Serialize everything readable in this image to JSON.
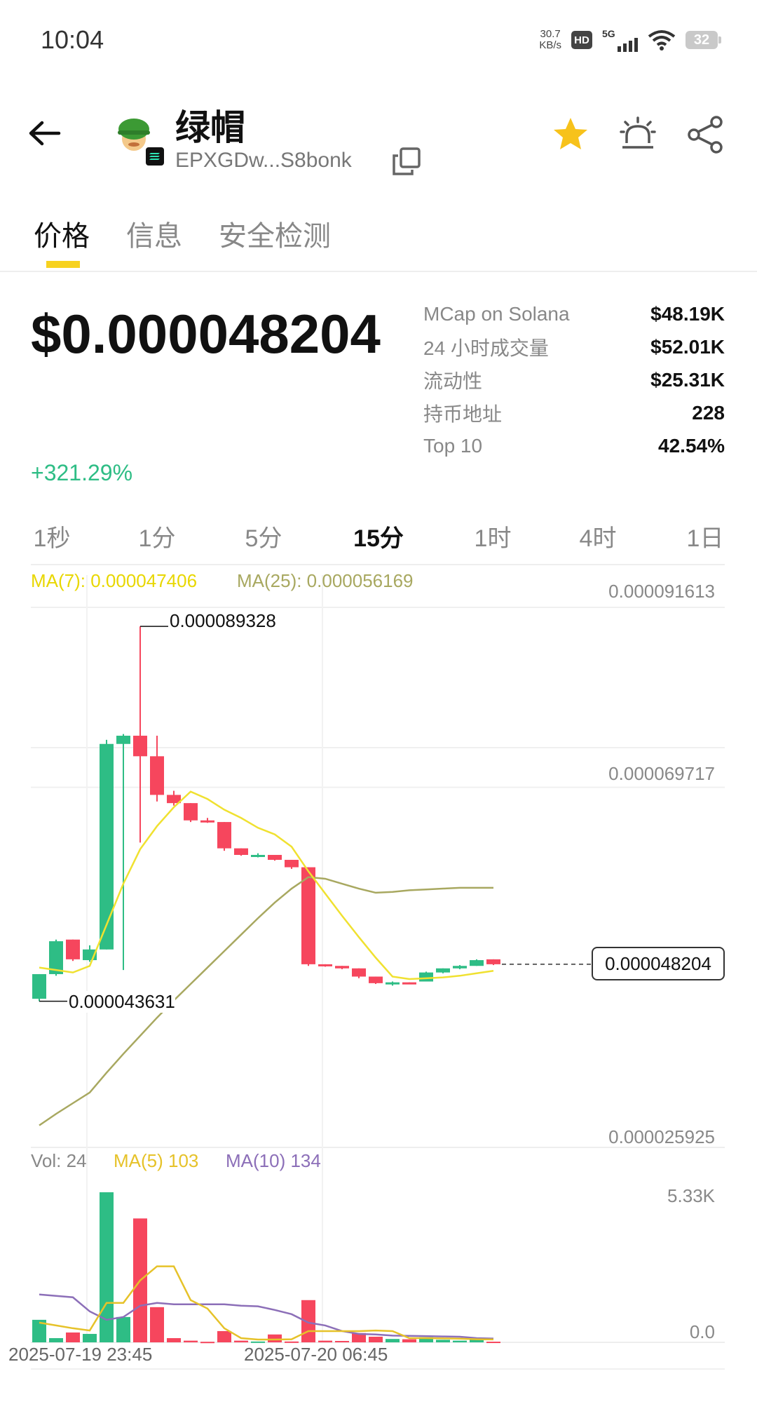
{
  "status": {
    "time": "10:04",
    "net_speed_value": "30.7",
    "net_speed_unit": "KB/s",
    "hd": "HD",
    "network": "5G",
    "battery": "32"
  },
  "header": {
    "token_name": "绿帽",
    "address": "EPXGDw...S8bonk",
    "icons": [
      "back-arrow-icon",
      "token-avatar",
      "solana-chain-icon",
      "copy-icon",
      "star-icon",
      "alarm-icon",
      "share-icon"
    ],
    "star_color": "#f7c21b"
  },
  "tabs": [
    {
      "label": "价格",
      "active": true
    },
    {
      "label": "信息",
      "active": false
    },
    {
      "label": "安全检测",
      "active": false
    }
  ],
  "price": {
    "value": "$0.000048204",
    "change": "+321.29%"
  },
  "stats": [
    {
      "label": "MCap on Solana",
      "value": "$48.19K"
    },
    {
      "label": "24 小时成交量",
      "value": "$52.01K"
    },
    {
      "label": "流动性",
      "value": "$25.31K"
    },
    {
      "label": "持币地址",
      "value": "228"
    },
    {
      "label": "Top 10",
      "value": "42.54%"
    }
  ],
  "timeframes": [
    {
      "label": "1秒",
      "active": false
    },
    {
      "label": "1分",
      "active": false
    },
    {
      "label": "5分",
      "active": false
    },
    {
      "label": "15分",
      "active": true
    },
    {
      "label": "1时",
      "active": false
    },
    {
      "label": "4时",
      "active": false
    },
    {
      "label": "1日",
      "active": false
    }
  ],
  "chart_legend": {
    "ma7": "MA(7): 0.000047406",
    "ma25": "MA(25): 0.000056169",
    "vol": "Vol: 24",
    "vma5": "MA(5) 103",
    "vma10": "MA(10) 134"
  },
  "colors": {
    "up": "#2ebd85",
    "down": "#f6465d",
    "ma7": "#f0e130",
    "ma25": "#a8a860",
    "vma5": "#e6c229",
    "vma10": "#8c6fb8"
  },
  "chart_data": {
    "type": "candlestick",
    "interval": "15分",
    "ylim": [
      2.5925e-05,
      9.1613e-05
    ],
    "y_ticks": [
      "0.000091613",
      "0.000069717",
      "0.000025925"
    ],
    "high_label": "0.000089328",
    "low_label": "0.000043631",
    "current_price_label": "0.000048204",
    "volume_ticks": [
      "5.33K",
      "0.0"
    ],
    "volume_max": 5330,
    "x_ticks": [
      "2025-07-19 23:45",
      "2025-07-20 06:45"
    ],
    "candles": [
      {
        "o": 4.4e-05,
        "h": 4.7e-05,
        "l": 4.37e-05,
        "c": 4.7e-05,
        "v": 800
      },
      {
        "o": 4.7e-05,
        "h": 5.12e-05,
        "l": 4.68e-05,
        "c": 5.1e-05,
        "v": 150
      },
      {
        "o": 5.12e-05,
        "h": 5.12e-05,
        "l": 4.86e-05,
        "c": 4.88e-05,
        "v": 350
      },
      {
        "o": 4.87e-05,
        "h": 5.05e-05,
        "l": 4.85e-05,
        "c": 5e-05,
        "v": 300
      },
      {
        "o": 5e-05,
        "h": 7.55e-05,
        "l": 5e-05,
        "c": 7.5e-05,
        "v": 5330
      },
      {
        "o": 7.5e-05,
        "h": 7.62e-05,
        "l": 4.75e-05,
        "c": 7.6e-05,
        "v": 900
      },
      {
        "o": 7.6e-05,
        "h": 8.93e-05,
        "l": 6.3e-05,
        "c": 7.35e-05,
        "v": 4400
      },
      {
        "o": 7.35e-05,
        "h": 7.6e-05,
        "l": 6.8e-05,
        "c": 6.88e-05,
        "v": 1250
      },
      {
        "o": 6.88e-05,
        "h": 6.93e-05,
        "l": 6.75e-05,
        "c": 6.78e-05,
        "v": 150
      },
      {
        "o": 6.78e-05,
        "h": 6.78e-05,
        "l": 6.55e-05,
        "c": 6.57e-05,
        "v": 60
      },
      {
        "o": 6.57e-05,
        "h": 6.6e-05,
        "l": 6.54e-05,
        "c": 6.55e-05,
        "v": 20
      },
      {
        "o": 6.55e-05,
        "h": 6.55e-05,
        "l": 6.2e-05,
        "c": 6.23e-05,
        "v": 400
      },
      {
        "o": 6.23e-05,
        "h": 6.23e-05,
        "l": 6.14e-05,
        "c": 6.15e-05,
        "v": 60
      },
      {
        "o": 6.14e-05,
        "h": 6.17e-05,
        "l": 6.12e-05,
        "c": 6.15e-05,
        "v": 30
      },
      {
        "o": 6.15e-05,
        "h": 6.15e-05,
        "l": 6.08e-05,
        "c": 6.09e-05,
        "v": 280
      },
      {
        "o": 6.09e-05,
        "h": 6.09e-05,
        "l": 5.98e-05,
        "c": 6e-05,
        "v": 30
      },
      {
        "o": 6e-05,
        "h": 6e-05,
        "l": 4.8e-05,
        "c": 4.82e-05,
        "v": 1500
      },
      {
        "o": 4.82e-05,
        "h": 4.82e-05,
        "l": 4.79e-05,
        "c": 4.8e-05,
        "v": 60
      },
      {
        "o": 4.8e-05,
        "h": 4.8e-05,
        "l": 4.76e-05,
        "c": 4.77e-05,
        "v": 50
      },
      {
        "o": 4.77e-05,
        "h": 4.77e-05,
        "l": 4.65e-05,
        "c": 4.67e-05,
        "v": 330
      },
      {
        "o": 4.67e-05,
        "h": 4.67e-05,
        "l": 4.58e-05,
        "c": 4.59e-05,
        "v": 200
      },
      {
        "o": 4.59e-05,
        "h": 4.61e-05,
        "l": 4.56e-05,
        "c": 4.6e-05,
        "v": 120
      },
      {
        "o": 4.6e-05,
        "h": 4.6e-05,
        "l": 4.58e-05,
        "c": 4.59e-05,
        "v": 110
      },
      {
        "o": 4.61e-05,
        "h": 4.73e-05,
        "l": 4.61e-05,
        "c": 4.72e-05,
        "v": 180
      },
      {
        "o": 4.72e-05,
        "h": 4.77e-05,
        "l": 4.71e-05,
        "c": 4.77e-05,
        "v": 90
      },
      {
        "o": 4.77e-05,
        "h": 4.81e-05,
        "l": 4.76e-05,
        "c": 4.8e-05,
        "v": 60
      },
      {
        "o": 4.8e-05,
        "h": 4.88e-05,
        "l": 4.8e-05,
        "c": 4.87e-05,
        "v": 90
      },
      {
        "o": 4.88e-05,
        "h": 4.88e-05,
        "l": 4.81e-05,
        "c": 4.82e-05,
        "v": 24
      }
    ],
    "ma7": [
      4.78e-05,
      4.75e-05,
      4.72e-05,
      4.8e-05,
      5.3e-05,
      5.8e-05,
      6.22e-05,
      6.5e-05,
      6.73e-05,
      6.92e-05,
      6.83e-05,
      6.7e-05,
      6.6e-05,
      6.48e-05,
      6.4e-05,
      6.25e-05,
      5.95e-05,
      5.68e-05,
      5.41e-05,
      5.15e-05,
      4.9e-05,
      4.67e-05,
      4.64e-05,
      4.65e-05,
      4.66e-05,
      4.68e-05,
      4.71e-05,
      4.74e-05
    ],
    "ma25": [
      2.86e-05,
      3e-05,
      3.13e-05,
      3.26e-05,
      3.5e-05,
      3.73e-05,
      3.95e-05,
      4.17e-05,
      4.38e-05,
      4.58e-05,
      4.78e-05,
      4.98e-05,
      5.18e-05,
      5.38e-05,
      5.57e-05,
      5.74e-05,
      5.88e-05,
      5.86e-05,
      5.8e-05,
      5.74e-05,
      5.69e-05,
      5.7e-05,
      5.72e-05,
      5.73e-05,
      5.74e-05,
      5.75e-05,
      5.75e-05,
      5.75e-05
    ],
    "vma5": [
      700,
      600,
      500,
      420,
      1400,
      1400,
      2200,
      2700,
      2700,
      1500,
      1200,
      500,
      150,
      100,
      100,
      110,
      400,
      400,
      400,
      400,
      420,
      400,
      150,
      150,
      140,
      130,
      110,
      103
    ],
    "vma10": [
      1700,
      1650,
      1600,
      1100,
      800,
      900,
      1300,
      1400,
      1350,
      1350,
      1350,
      1350,
      1300,
      1280,
      1150,
      1000,
      700,
      600,
      400,
      300,
      280,
      240,
      230,
      220,
      210,
      200,
      150,
      134
    ]
  }
}
